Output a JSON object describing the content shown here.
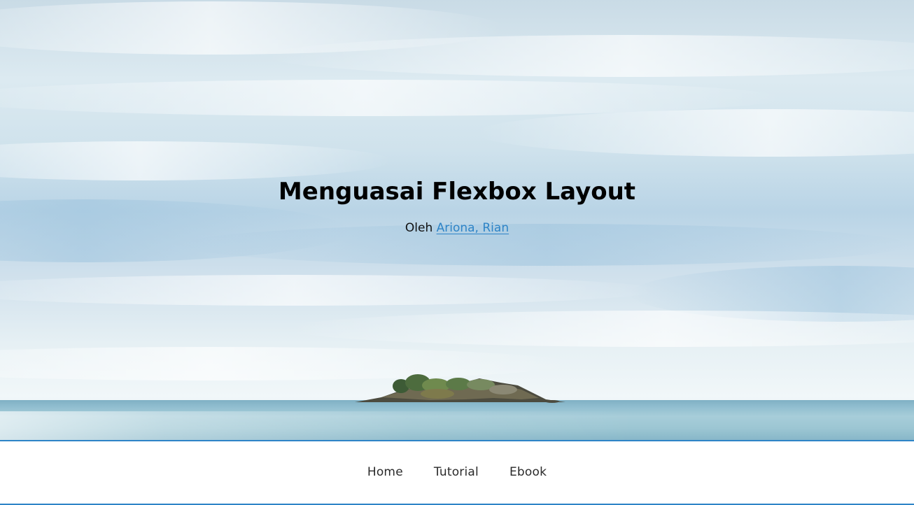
{
  "hero": {
    "title": "Menguasai Flexbox Layout",
    "byline_prefix": "Oleh",
    "author": "Ariona, Rian",
    "background": "island-in-sea-photo"
  },
  "nav": {
    "items": [
      {
        "label": "Home"
      },
      {
        "label": "Tutorial"
      },
      {
        "label": "Ebook"
      }
    ]
  },
  "colors": {
    "accent": "#2e84c7",
    "text": "#000000",
    "nav_text": "#2a2a2a"
  }
}
